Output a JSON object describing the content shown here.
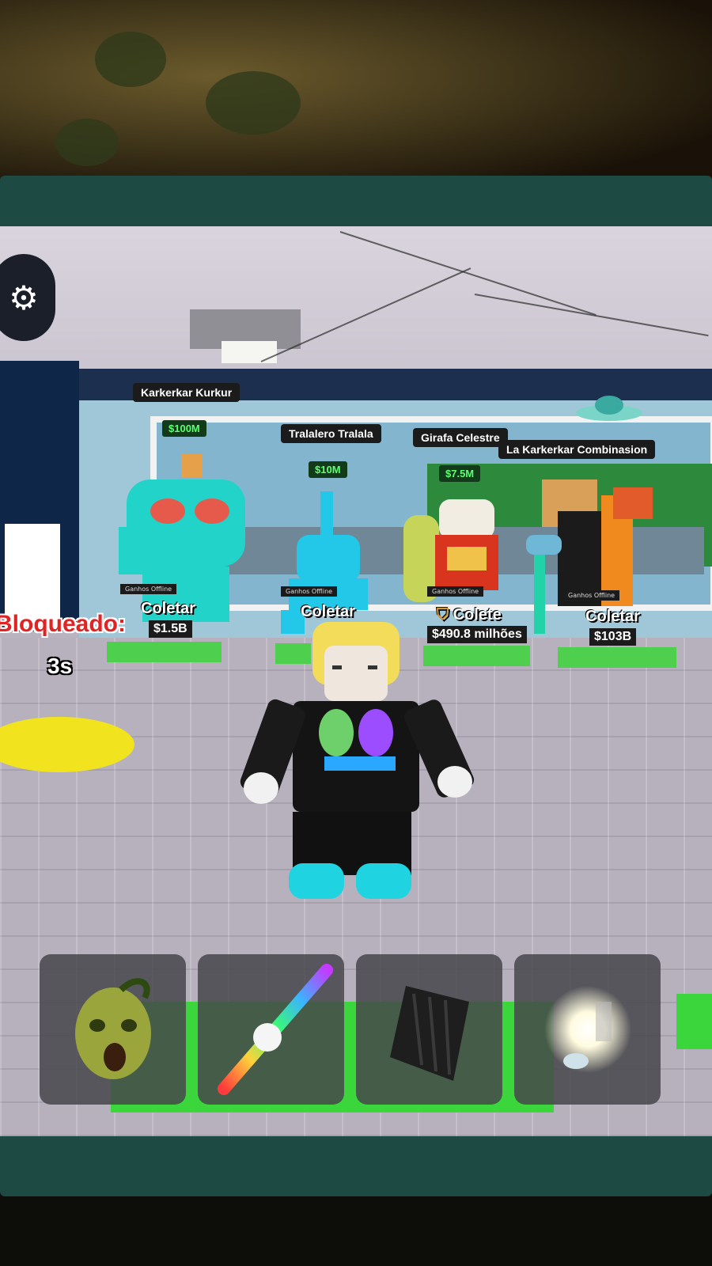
{
  "game": {
    "brainrots": [
      {
        "name": "Karkerkar Kurkur",
        "rate": "$100M",
        "action": "Coletar",
        "amount": "$1.5B"
      },
      {
        "name": "Tralalero Tralala",
        "rate": "$10M",
        "action": "Coletar",
        "amount": ""
      },
      {
        "name": "Girafa Celestre",
        "rate": "$7.5M",
        "action": "Colete",
        "amount": "$490.8 milhões"
      },
      {
        "name": "La Karkerkar Combinasion",
        "rate": "",
        "action": "Coletar",
        "amount": "$103B"
      }
    ],
    "base_lock": {
      "label": "Bloqueado:",
      "timer": "3s"
    }
  },
  "hotbar": {
    "slots": [
      {
        "icon": "zombie-head-icon"
      },
      {
        "icon": "rainbow-bat-icon"
      },
      {
        "icon": "invisibility-cloak-icon"
      },
      {
        "icon": "glowing-orb-icon"
      }
    ]
  },
  "colors": {
    "podium_green": "#4ecf4e",
    "locked_red": "#e02424",
    "rate_green": "#5cff73"
  }
}
